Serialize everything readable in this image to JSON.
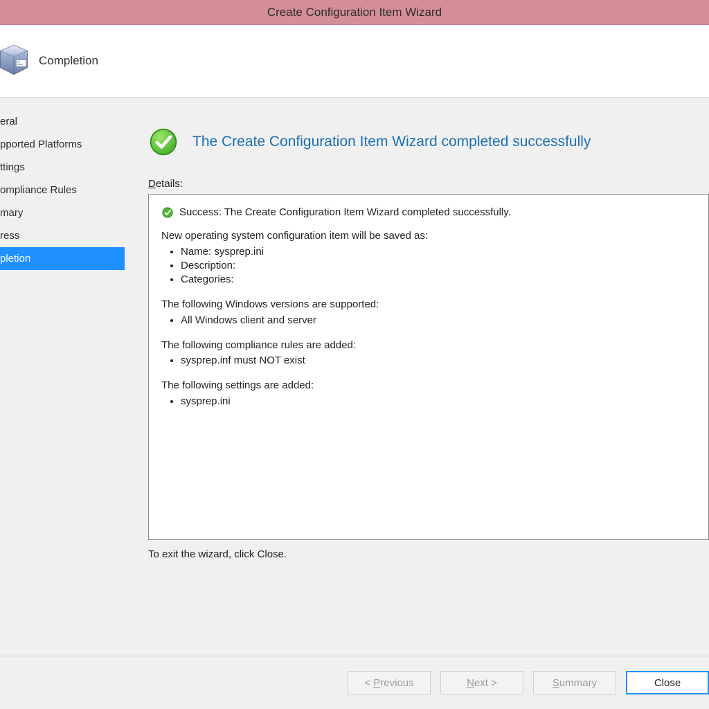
{
  "titlebar": {
    "title": "Create Configuration Item Wizard"
  },
  "header": {
    "step_title": "Completion"
  },
  "sidebar": {
    "items": [
      {
        "label": "eral"
      },
      {
        "label": "pported Platforms"
      },
      {
        "label": "ttings"
      },
      {
        "label": "ompliance Rules"
      },
      {
        "label": "mary"
      },
      {
        "label": "ress"
      },
      {
        "label": "pletion"
      }
    ]
  },
  "content": {
    "success_headline": "The Create Configuration Item Wizard completed successfully",
    "details_label_prefix": "D",
    "details_label_rest": "etails:",
    "success_line": "Success: The Create Configuration Item Wizard completed successfully.",
    "group1_title": "New operating system configuration item will be saved as:",
    "group1_items": [
      "Name: sysprep.ini",
      "Description:",
      "Categories:"
    ],
    "group2_title": "The following Windows versions are supported:",
    "group2_items": [
      "All Windows client and server"
    ],
    "group3_title": "The following compliance rules are added:",
    "group3_items": [
      "sysprep.inf must NOT exist"
    ],
    "group4_title": "The following settings are added:",
    "group4_items": [
      "sysprep.ini"
    ],
    "exit_hint": "To exit the wizard, click Close."
  },
  "footer": {
    "previous_prefix": "< ",
    "previous_ul": "P",
    "previous_rest": "revious",
    "next_ul": "N",
    "next_rest": "ext >",
    "summary_ul": "S",
    "summary_rest": "ummary",
    "close": "Close"
  }
}
